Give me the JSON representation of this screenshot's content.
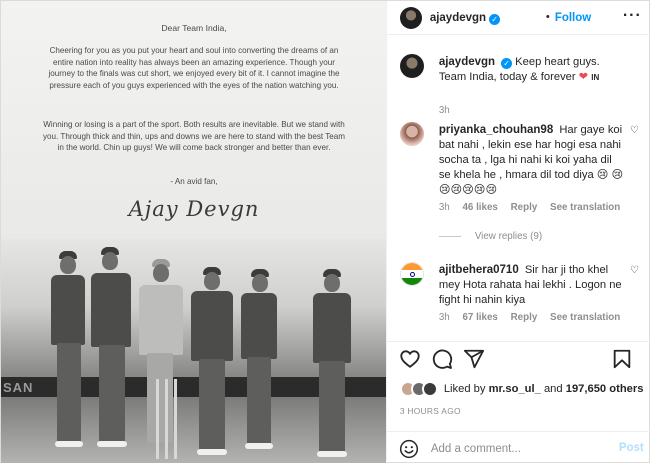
{
  "letter": {
    "greeting": "Dear Team India,",
    "paragraph_1": "Cheering for you as you put your heart and soul into converting the dreams of an entire nation into reality has always been an amazing experience. Though your journey to the finals was cut short, we enjoyed every bit of it. I cannot imagine the pressure each of you guys experienced with the eyes of the nation watching you.",
    "paragraph_2": "Winning or losing is a part of the sport. Both results are inevitable. But we stand with you. Through thick and thin, ups and downs we are here to stand with the best Team in the world. Chin up guys! We will come back stronger and better than ever.",
    "signoff": "- An avid fan,",
    "signature": "Ajay Devgn",
    "billboard_text": "SAN"
  },
  "header": {
    "username": "ajaydevgn",
    "verified_glyph": "✓",
    "dot": "•",
    "follow_label": "Follow",
    "more_glyph": "···"
  },
  "caption": {
    "username": "ajaydevgn",
    "text_before": "Keep heart guys. Team India, today & forever",
    "heart": "❤",
    "country": "IN",
    "time": "3h"
  },
  "comments": [
    {
      "username": "priyanka_chouhan98",
      "text": "Har gaye koi bat nahi , lekin ese har hogi esa nahi socha ta , lga hi nahi ki koi yaha dil se khela he , hmara dil tod diya 😢",
      "text_tail": "😢😢😢😢😢😢",
      "time": "3h",
      "likes": "46 likes",
      "reply": "Reply",
      "translate": "See translation",
      "view_replies": "View replies (9)"
    },
    {
      "username": "ajitbehera0710",
      "text": "Sir har ji tho khel mey Hota rahata hai lekhi . Logon ne fight hi nahin kiya",
      "time": "3h",
      "likes": "67 likes",
      "reply": "Reply",
      "translate": "See translation"
    }
  ],
  "likes": {
    "prefix": "Liked by",
    "user": "mr.so_ul_",
    "middle": "and",
    "count": "197,650 others"
  },
  "timestamp": "3 HOURS AGO",
  "add_comment": {
    "placeholder": "Add a comment...",
    "post_label": "Post"
  },
  "colors": {
    "accent": "#0095f6",
    "heart": "#ed4956",
    "muted": "#8e8e8e",
    "post_disabled": "#b2dffc"
  },
  "icons": [
    "verified-icon",
    "more-icon",
    "heart-icon",
    "comment-icon",
    "share-icon",
    "bookmark-icon",
    "emoji-icon"
  ]
}
